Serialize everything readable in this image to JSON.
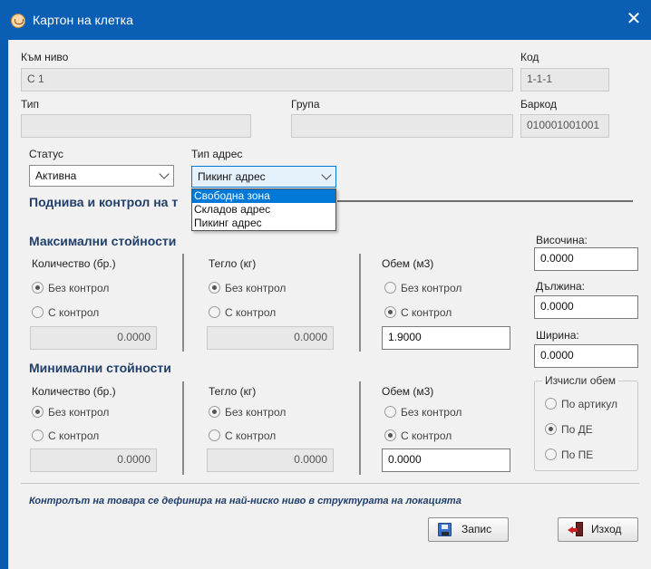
{
  "window": {
    "title": "Картон на клетка"
  },
  "top": {
    "to_level_label": "Към ниво",
    "to_level_value": "С 1",
    "code_label": "Код",
    "code_value": "1-1-1",
    "type_label": "Тип",
    "type_value": "",
    "group_label": "Група",
    "group_value": "",
    "barcode_label": "Баркод",
    "barcode_value": "010001001001",
    "status_label": "Статус",
    "status_value": "Активна",
    "address_type_label": "Тип адрес",
    "address_type_value": "Пикинг адрес",
    "address_type_options": [
      "Свободна зона",
      "Складов адрес",
      "Пикинг адрес"
    ],
    "address_type_highlighted": "Свободна зона"
  },
  "section_title": "Поднива и контрол на т",
  "max": {
    "title": "Максимални стойности",
    "qty_label": "Количество (бр.)",
    "weight_label": "Тегло (кг)",
    "volume_label": "Обем (м3)",
    "no_control": "Без контрол",
    "with_control": "С контрол",
    "qty_value": "0.0000",
    "weight_value": "0.0000",
    "volume_value": "1.9000"
  },
  "min": {
    "title": "Минимални стойности",
    "qty_label": "Количество (бр.)",
    "weight_label": "Тегло (кг)",
    "volume_label": "Обем (м3)",
    "no_control": "Без контрол",
    "with_control": "С контрол",
    "qty_value": "0.0000",
    "weight_value": "0.0000",
    "volume_value": "0.0000"
  },
  "dimensions": {
    "height_label": "Височина:",
    "height_value": "0.0000",
    "length_label": "Дължина:",
    "length_value": "0.0000",
    "width_label": "Ширина:",
    "width_value": "0.0000"
  },
  "calc_volume": {
    "legend": "Изчисли обем",
    "by_article": "По артикул",
    "by_de": "По ДЕ",
    "by_pe": "По ПЕ"
  },
  "footer": {
    "note": "Контролът на товара се дефинира на най-ниско ниво в структурата на локацията",
    "save_label": "Запис",
    "exit_label": "Изход"
  },
  "icons": {
    "app": "warehouse-app-icon",
    "close": "close-icon",
    "save": "floppy-disk-icon",
    "exit": "exit-door-icon",
    "chevron": "chevron-down-icon"
  }
}
